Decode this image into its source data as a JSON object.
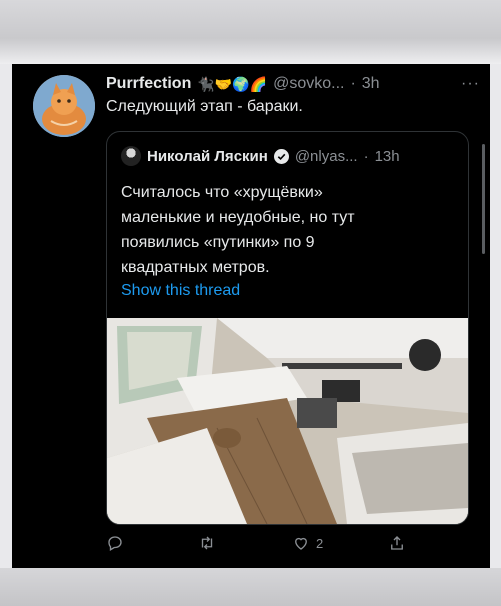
{
  "tweet": {
    "author_name": "Purrfection",
    "author_emojis": "🐈‍⬛🤝🌍🌈",
    "handle": "@sovko...",
    "separator": "·",
    "time": "3h",
    "more": "···",
    "text": "Следующий этап - бараки."
  },
  "quote": {
    "author_name": "Николай Ляскин",
    "handle": "@nlyas...",
    "separator": "·",
    "time": "13h",
    "text": "Считалось что «хрущёвки» маленькие и неудобные, но тут появились «путинки» по 9 квадратных метров.",
    "show_thread": "Show this thread"
  },
  "actions": {
    "reply_count": "",
    "retweet_count": "",
    "like_count": "2",
    "share_count": ""
  },
  "colors": {
    "background": "#000000",
    "text": "#e7e9ea",
    "muted": "#8b8f94",
    "link": "#1d9bf0",
    "border": "#2f3336"
  },
  "icons": [
    "reply-icon",
    "retweet-icon",
    "like-icon",
    "share-icon",
    "verified-badge-icon",
    "more-icon"
  ]
}
